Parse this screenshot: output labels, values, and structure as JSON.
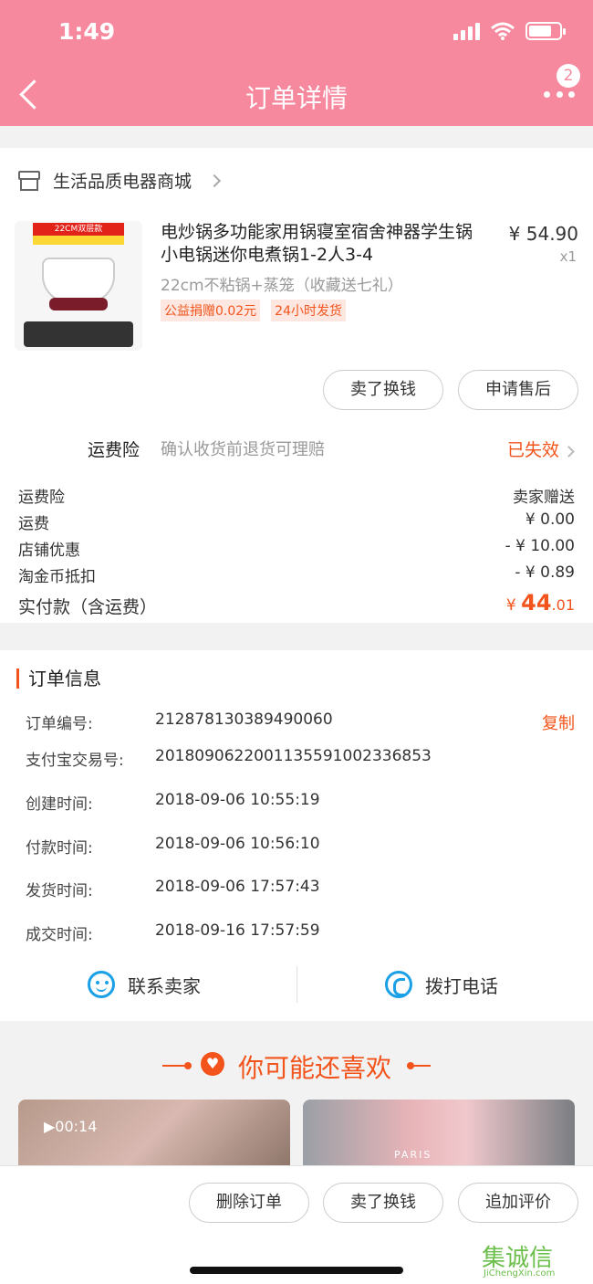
{
  "status_bar": {
    "time": "1:49"
  },
  "header": {
    "title": "订单详情",
    "badge_count": "2"
  },
  "shop": {
    "name": "生活品质电器商城"
  },
  "product": {
    "title": "电炒锅多功能家用锅寝室宿舍神器学生锅小电锅迷你电煮锅1-2人3-4",
    "price": "¥ 54.90",
    "qty": "x1",
    "spec": "22cm不粘锅+蒸笼（收藏送七礼）",
    "tags": [
      "公益捐赠0.02元",
      "24小时发货"
    ],
    "img_label": "22CM双层款"
  },
  "item_actions": {
    "sell": "卖了换钱",
    "after_sale": "申请售后"
  },
  "insurance": {
    "label": "运费险",
    "desc": "确认收货前退货可理赔",
    "status": "已失效"
  },
  "fees": [
    {
      "label": "运费险",
      "value": "卖家赠送"
    },
    {
      "label": "运费",
      "value": "¥ 0.00"
    },
    {
      "label": "店铺优惠",
      "value": "- ¥ 10.00"
    },
    {
      "label": "淘金币抵扣",
      "value": "- ¥ 0.89"
    }
  ],
  "total": {
    "label": "实付款（含运费）",
    "currency": "¥ ",
    "integer": "44",
    "decimal": ".01"
  },
  "order_info": {
    "title": "订单信息",
    "copy": "复制",
    "rows": [
      {
        "label": "订单编号:",
        "value": "212878130389490060"
      },
      {
        "label": "支付宝交易号:",
        "value": "2018090622001135591002336853"
      },
      {
        "label": "创建时间:",
        "value": "2018-09-06 10:55:19"
      },
      {
        "label": "付款时间:",
        "value": "2018-09-06 10:56:10"
      },
      {
        "label": "发货时间:",
        "value": "2018-09-06 17:57:43"
      },
      {
        "label": "成交时间:",
        "value": "2018-09-16 17:57:59"
      }
    ]
  },
  "contact": {
    "seller": "联系卖家",
    "call": "拨打电话"
  },
  "recommend": {
    "title": "你可能还喜欢",
    "video_time": "▶00:14",
    "brand_text": "PARIS"
  },
  "bottom_actions": {
    "delete": "删除订单",
    "sell": "卖了换钱",
    "review": "追加评价"
  },
  "watermark": {
    "name": "集诚信",
    "url": "JiChengXin.com"
  },
  "colors": {
    "header": "#f7899f",
    "accent": "#f2541c",
    "icon_blue": "#1aa0e6"
  }
}
